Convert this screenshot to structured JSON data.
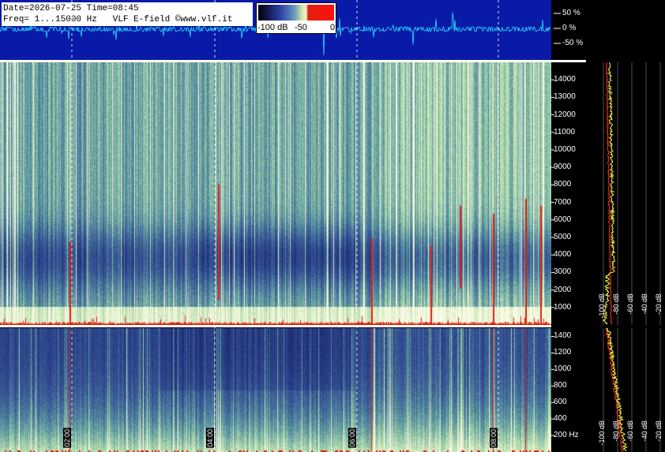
{
  "header": {
    "date_line": "Date=2026-07-25 Time=08:45",
    "freq_line": "Freq= 1...15000 Hz   VLF E-field ©www.vlf.it"
  },
  "colorbar": {
    "labels": [
      "-100 dB",
      "-50",
      "0"
    ]
  },
  "waveform": {
    "pct_labels": [
      "50 %",
      "0 %",
      "-50 %"
    ]
  },
  "colors": {
    "background": "#000000",
    "waveform_bg": "#0a1aa8",
    "waveform_trace": "#28e0ff",
    "spectrum_yellow": "#ffff40",
    "spectrum_red": "#ff3020",
    "grid_dash": "#ffffff"
  },
  "chart_data": [
    {
      "type": "heatmap",
      "title": "",
      "xlabel": "",
      "ylabel": "",
      "time_ticks": [
        "02:00",
        "04:00",
        "06:00",
        "08:00"
      ],
      "freq_ticks_upper": [
        "1000",
        "2000",
        "3000",
        "4000",
        "5000",
        "6000",
        "7000",
        "8000",
        "9000",
        "10000",
        "11000",
        "12000",
        "13000",
        "14000"
      ],
      "freq_ticks_lower": [
        "200 Hz",
        "400",
        "600",
        "800",
        "1000",
        "1200",
        "1400"
      ],
      "ylim_upper": [
        0,
        15000
      ],
      "ylim_lower": [
        0,
        1500
      ],
      "color_scale_db": [
        -100,
        0
      ]
    },
    {
      "type": "line",
      "title": "",
      "db_ticks_upper": [
        "-100 dB",
        "-80 dB",
        "-60 dB",
        "-40 dB",
        "-20 dB"
      ],
      "db_ticks_lower": [
        "-100 dB",
        "-80 dB",
        "-60 dB",
        "-40 dB",
        "-20 dB"
      ],
      "xlim": [
        -100,
        -20
      ]
    }
  ]
}
